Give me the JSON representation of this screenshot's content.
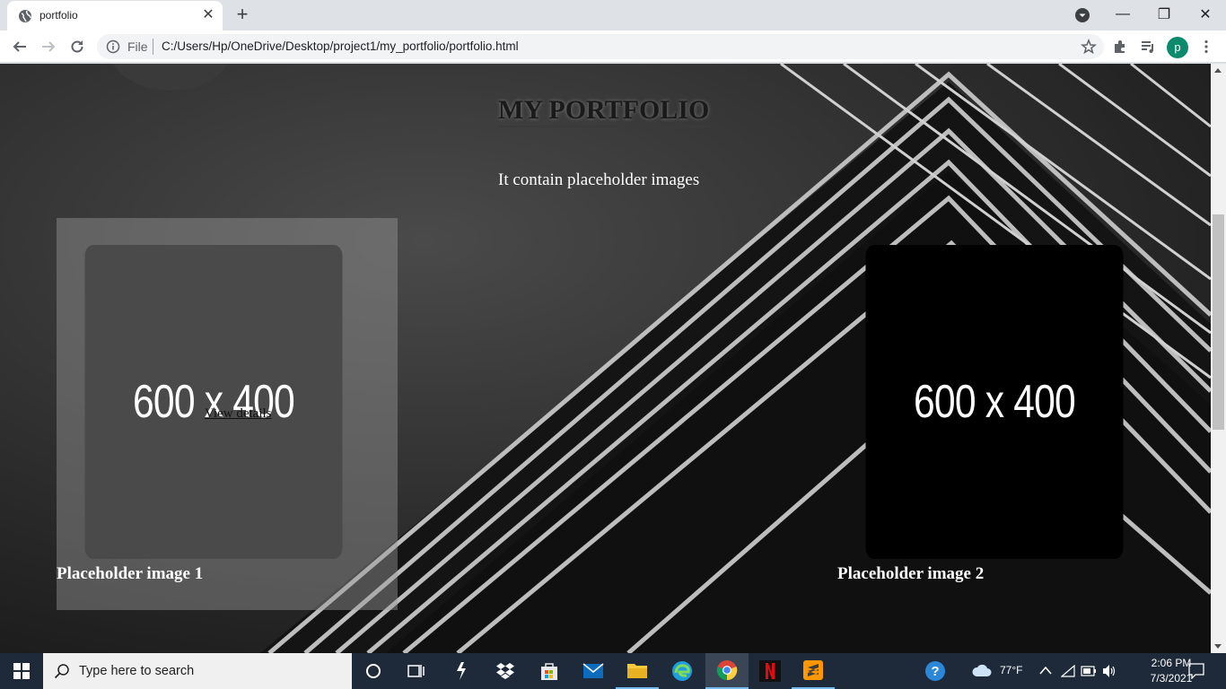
{
  "browser": {
    "tab_title": "portfolio",
    "url_scheme": "File",
    "url": "C:/Users/Hp/OneDrive/Desktop/project1/my_portfolio/portfolio.html",
    "avatar_letter": "p"
  },
  "page": {
    "title": "MY PORTFOLIO",
    "subtitle": "It contain placeholder images",
    "cards": [
      {
        "image_text": "600 x 400",
        "caption": "Placeholder image 1",
        "link": "View details"
      },
      {
        "image_text": "600 x 400",
        "caption": "Placeholder image 2"
      }
    ]
  },
  "taskbar": {
    "search_placeholder": "Type here to search",
    "weather": "77°F",
    "time": "2:06 PM",
    "date": "7/3/2021"
  },
  "colors": {
    "accent": "#0b8a6c",
    "taskbar": "#1e2a3a"
  }
}
